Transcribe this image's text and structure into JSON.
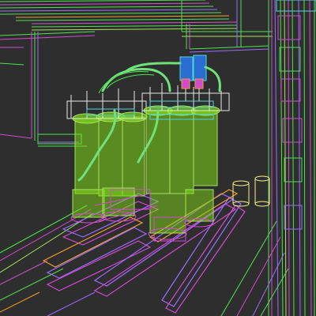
{
  "viewport": {
    "mode": "wireframe",
    "background": "#2e2e2e",
    "colors": {
      "cabinet": "#4fe04f",
      "cabinet_alt": "#a4e35a",
      "magenta": "#d24bd2",
      "violet": "#9b6cff",
      "cyan": "#4fd6e6",
      "orange": "#f0a030",
      "yellow": "#f4f08a",
      "tube": "#6fe07a",
      "reactor_fill": "#7fd818",
      "blue": "#2a6cd0",
      "white": "#e8e8e8"
    },
    "icons": [
      "pipe-icon",
      "motor-icon",
      "reactor-icon",
      "rail-icon"
    ]
  }
}
